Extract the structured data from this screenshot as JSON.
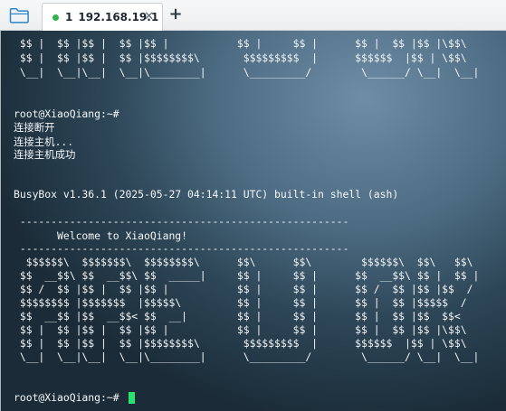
{
  "toolbar": {
    "folder_icon": "folder-icon",
    "new_tab_symbol": "+"
  },
  "tab": {
    "index": "1",
    "label": "192.168.19.1",
    "close_symbol": "✕",
    "status_color": "#32b14a"
  },
  "terminal": {
    "lines": [
      " $$ |  $$ |$$ |  $$ |$$ |           $$ |     $$ |      $$ |  $$ |$$ |\\$$\\",
      " $$ |  $$ |$$ |  $$ |$$$$$$$$\\       $$$$$$$$$  |      $$$$$$  |$$ | \\$$\\",
      " \\__|  \\__|\\__|  \\__|\\________|      \\_________/        \\______/ \\__|  \\__|",
      "",
      "",
      "root@XiaoQiang:~#",
      "连接断开",
      "连接主机...",
      "连接主机成功",
      "",
      "",
      "",
      "BusyBox v1.36.1 (2025-05-27 04:14:11 UTC) built-in shell (ash)",
      "",
      " -----------------------------------------------------",
      "       Welcome to XiaoQiang!",
      " -----------------------------------------------------",
      "  $$$$$$\\  $$$$$$$\\  $$$$$$$$\\      $$\\      $$\\        $$$$$$\\  $$\\   $$\\",
      " $$  __$$\\ $$  __$$\\ $$  _____|     $$ |     $$ |      $$  __$$\\ $$ |  $$ |",
      " $$ /  $$ |$$ |  $$ |$$ |           $$ |     $$ |      $$ /  $$ |$$ |$$  /",
      " $$$$$$$$ |$$$$$$$  |$$$$$\\         $$ |     $$ |      $$ |  $$ |$$$$$  /",
      " $$  __$$ |$$  __$$< $$  __|        $$ |     $$ |      $$ |  $$ |$$  $$<",
      " $$ |  $$ |$$ |  $$ |$$ |           $$ |     $$ |      $$ |  $$ |$$ |\\$$\\",
      " $$ |  $$ |$$ |  $$ |$$$$$$$$\\       $$$$$$$$$  |      $$$$$$  |$$ | \\$$\\",
      " \\__|  \\__|\\__|  \\__|\\________|      \\_________/        \\______/ \\__|  \\__|",
      "",
      "",
      "root@XiaoQiang:~#"
    ],
    "cursor_color": "#27e36f"
  }
}
